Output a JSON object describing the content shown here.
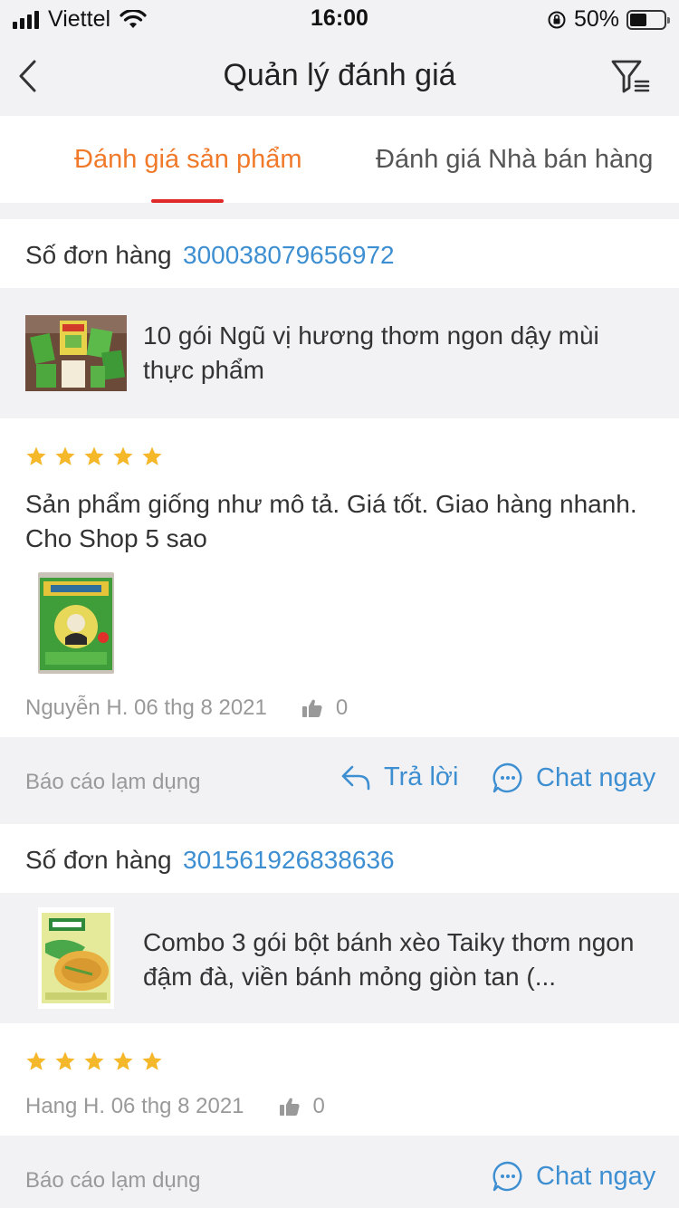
{
  "status_bar": {
    "carrier": "Viettel",
    "time": "16:00",
    "battery": "50%",
    "battery_level": 0.5
  },
  "nav": {
    "title": "Quản lý đánh giá"
  },
  "tabs": [
    {
      "label": "Đánh giá sản phẩm",
      "active": true
    },
    {
      "label": "Đánh giá Nhà bán hàng",
      "active": false
    }
  ],
  "reviews": [
    {
      "order_label": "Số đơn hàng",
      "order_number": "300038079656972",
      "product_name": "10 gói Ngũ vị hương thơm ngon dậy mùi thực phẩm",
      "rating": 5,
      "review_text": "Sản phẩm giống như mô tả. Giá tốt. Giao hàng nhanh. Cho Shop 5 sao",
      "meta": "Nguyễn H. 06 thg 8 2021",
      "likes": "0",
      "report_label": "Báo cáo lạm dụng",
      "reply_label": "Trả lời",
      "chat_label": "Chat ngay"
    },
    {
      "order_label": "Số đơn hàng",
      "order_number": "301561926838636",
      "product_name": "Combo 3 gói bột bánh xèo Taiky thơm ngon đậm đà, viền bánh mỏng giòn tan (...",
      "rating": 5,
      "meta": "Hang H. 06 thg 8 2021",
      "likes": "0",
      "report_label": "Báo cáo lạm dụng",
      "chat_label": "Chat ngay"
    }
  ],
  "colors": {
    "accent": "#f07a2a",
    "link": "#3d8fd1",
    "star": "#f5b82a",
    "tab_indicator": "#e02a2a"
  }
}
